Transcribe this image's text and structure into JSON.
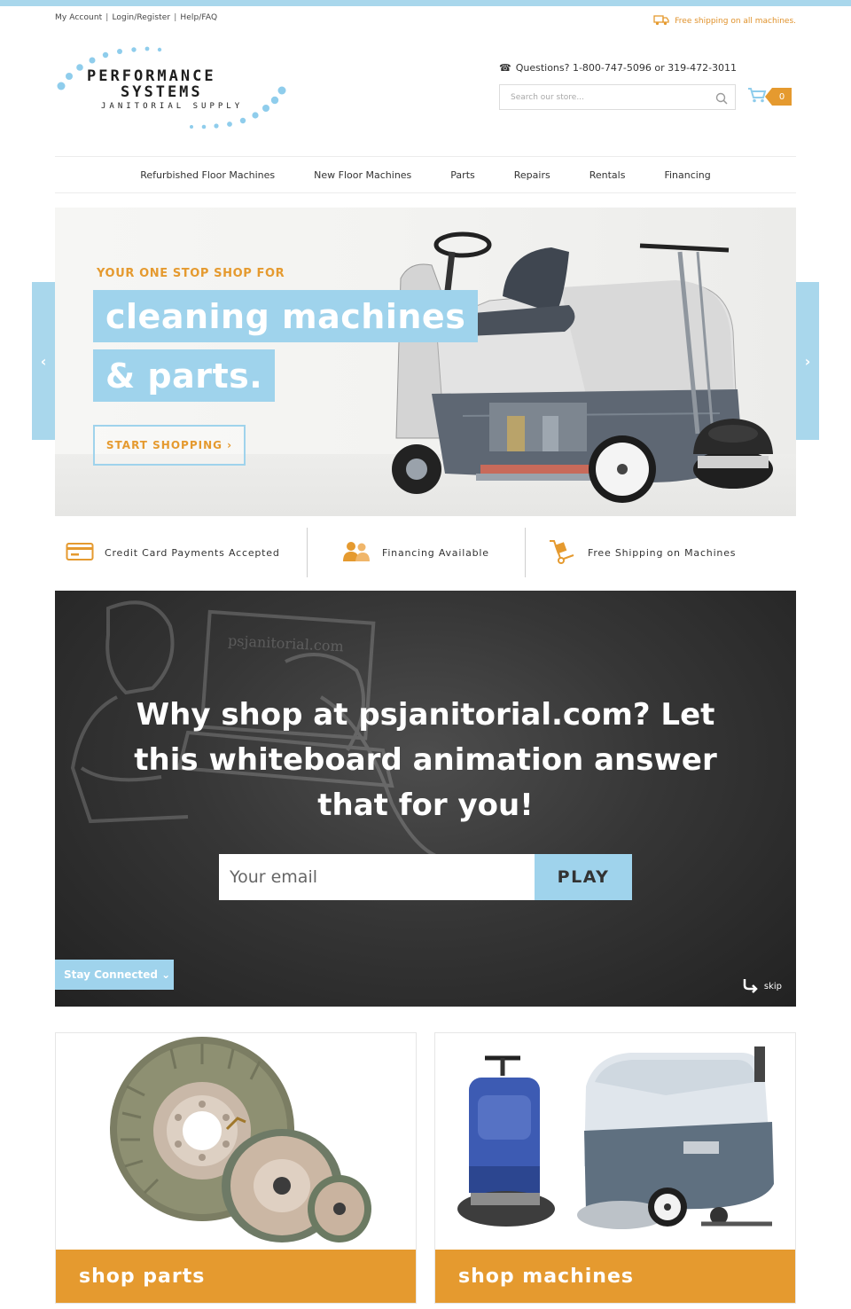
{
  "header": {
    "util_links": [
      "My Account",
      "Login/Register",
      "Help/FAQ"
    ],
    "free_shipping_note": "Free shipping on all machines.",
    "logo": {
      "line1": "PERFORMANCE",
      "line2": "SYSTEMS",
      "line3": "JANITORIAL SUPPLY"
    },
    "questions": "Questions? 1-800-747-5096 or 319-472-3011",
    "search_placeholder": "Search our store...",
    "cart_count": "0"
  },
  "nav": {
    "items": [
      "Refurbished Floor Machines",
      "New Floor Machines",
      "Parts",
      "Repairs",
      "Rentals",
      "Financing"
    ]
  },
  "hero": {
    "eyebrow": "YOUR ONE STOP SHOP FOR",
    "line1": "cleaning machines",
    "line2": "& parts.",
    "cta": "START SHOPPING ›",
    "prev": "‹",
    "next": "›"
  },
  "features": [
    {
      "label": "Credit Card Payments Accepted",
      "icon": "credit-card-icon"
    },
    {
      "label": "Financing Available",
      "icon": "people-icon"
    },
    {
      "label": "Free Shipping on Machines",
      "icon": "hand-truck-icon"
    }
  ],
  "video": {
    "title": "Why shop at psjanitorial.com? Let this whiteboard animation answer that for you!",
    "email_placeholder": "Your email",
    "play_label": "PLAY",
    "stay_connected": "Stay Connected ⌄",
    "skip_label": "skip"
  },
  "cards": {
    "parts_label": "shop parts",
    "machines_label": "shop machines"
  },
  "colors": {
    "accent_blue": "#9fd3ec",
    "accent_orange": "#e59a2f",
    "video_bg": "#363636"
  }
}
